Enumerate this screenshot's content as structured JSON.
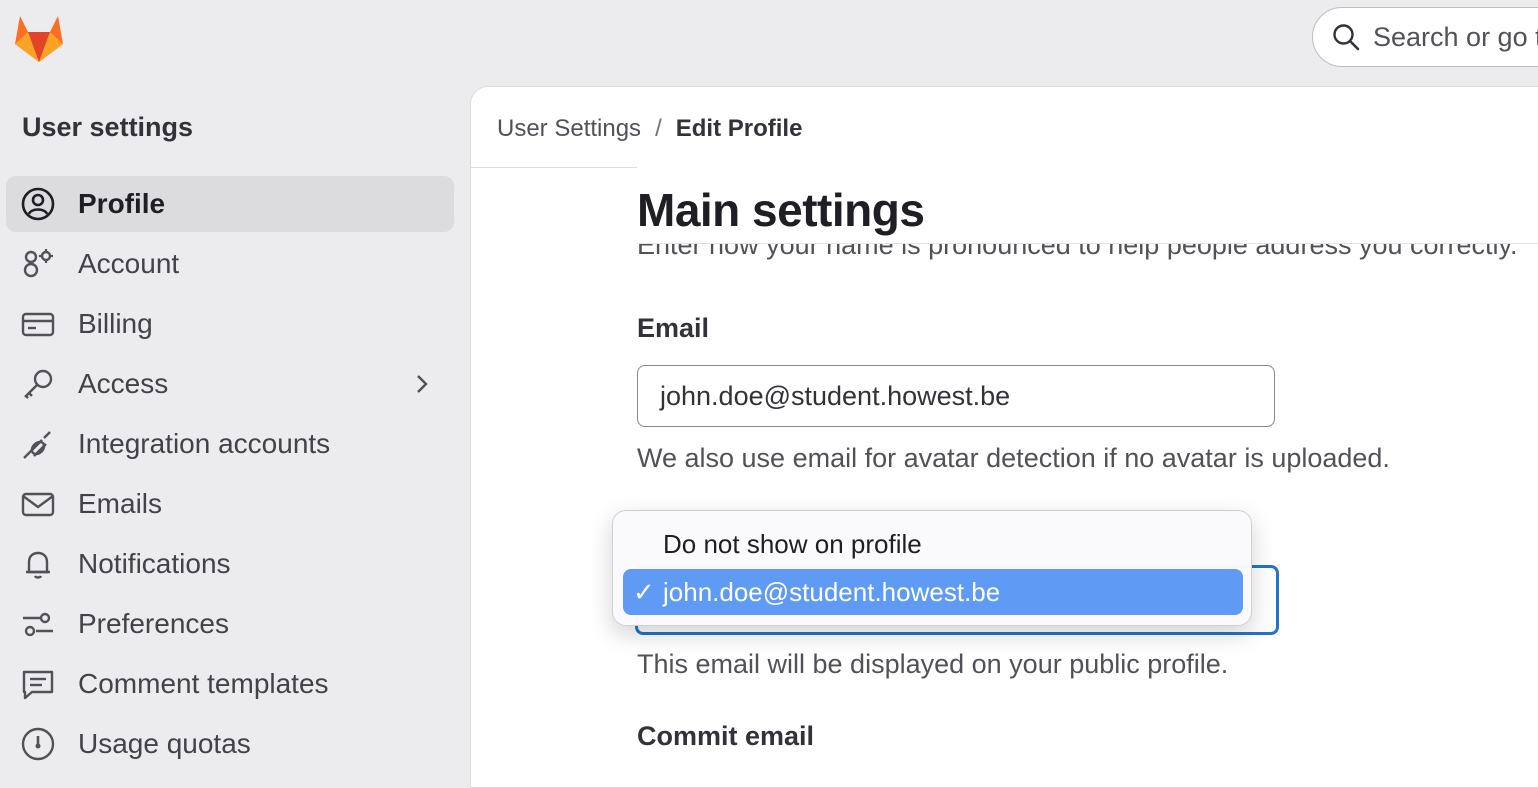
{
  "search": {
    "placeholder": "Search or go to…"
  },
  "sidebar": {
    "title": "User settings",
    "items": [
      {
        "label": "Profile",
        "icon": "profile-icon",
        "active": true
      },
      {
        "label": "Account",
        "icon": "account-icon"
      },
      {
        "label": "Billing",
        "icon": "billing-icon"
      },
      {
        "label": "Access",
        "icon": "key-icon",
        "has_submenu": true
      },
      {
        "label": "Integration accounts",
        "icon": "plug-icon"
      },
      {
        "label": "Emails",
        "icon": "mail-icon"
      },
      {
        "label": "Notifications",
        "icon": "bell-icon"
      },
      {
        "label": "Preferences",
        "icon": "preferences-icon"
      },
      {
        "label": "Comment templates",
        "icon": "comment-icon"
      },
      {
        "label": "Usage quotas",
        "icon": "gauge-icon"
      }
    ]
  },
  "breadcrumb": {
    "root": "User Settings",
    "separator": "/",
    "current": "Edit Profile"
  },
  "main": {
    "title": "Main settings",
    "pronunciation_help": "Enter how your name is pronounced to help people address you correctly.",
    "email": {
      "label": "Email",
      "value": "john.doe@student.howest.be",
      "help": "We also use email for avatar detection if no avatar is uploaded."
    },
    "public_email": {
      "help": "This email will be displayed on your public profile.",
      "options": [
        "Do not show on profile",
        "john.doe@student.howest.be"
      ],
      "selected": "john.doe@student.howest.be",
      "check_mark": "✓"
    },
    "commit_email": {
      "label": "Commit email"
    }
  },
  "colors": {
    "accent": "#1f75cb",
    "selected_option": "#5f9bf4",
    "logo": "#e24329"
  }
}
